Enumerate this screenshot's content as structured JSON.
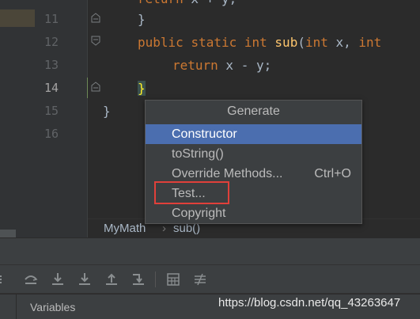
{
  "editor": {
    "line_numbers": [
      "11",
      "12",
      "13",
      "14",
      "15",
      "16"
    ],
    "lines": {
      "l10": {
        "kw": "return",
        "rest": " x + y;"
      },
      "l11": "}",
      "l12": {
        "kw1": "public",
        "kw2": "static",
        "kw3": "int",
        "fn": "sub",
        "params_open": "(",
        "kw4": "int",
        "p1": " x, ",
        "kw5": "int"
      },
      "l13": {
        "kw": "return",
        "rest": " x - y;"
      },
      "l14": "}",
      "l15": "}"
    }
  },
  "breadcrumb": {
    "class_name": "MyMath",
    "separator": "›",
    "method_name": "sub()"
  },
  "generate_popup": {
    "title": "Generate",
    "items": [
      {
        "label": "Constructor",
        "shortcut": ""
      },
      {
        "label": "toString()",
        "shortcut": ""
      },
      {
        "label": "Override Methods...",
        "shortcut": "Ctrl+O"
      },
      {
        "label": "Test...",
        "shortcut": ""
      },
      {
        "label": "Copyright",
        "shortcut": ""
      }
    ],
    "selected_index": 0
  },
  "debug_panel": {
    "variables_tab": "Variables"
  },
  "watermark": "https://blog.csdn.net/qq_43263647",
  "colors": {
    "keyword": "#cc7832",
    "function": "#ffc66d",
    "selection": "#4b6eaf",
    "highlight_box": "#e0403a"
  }
}
